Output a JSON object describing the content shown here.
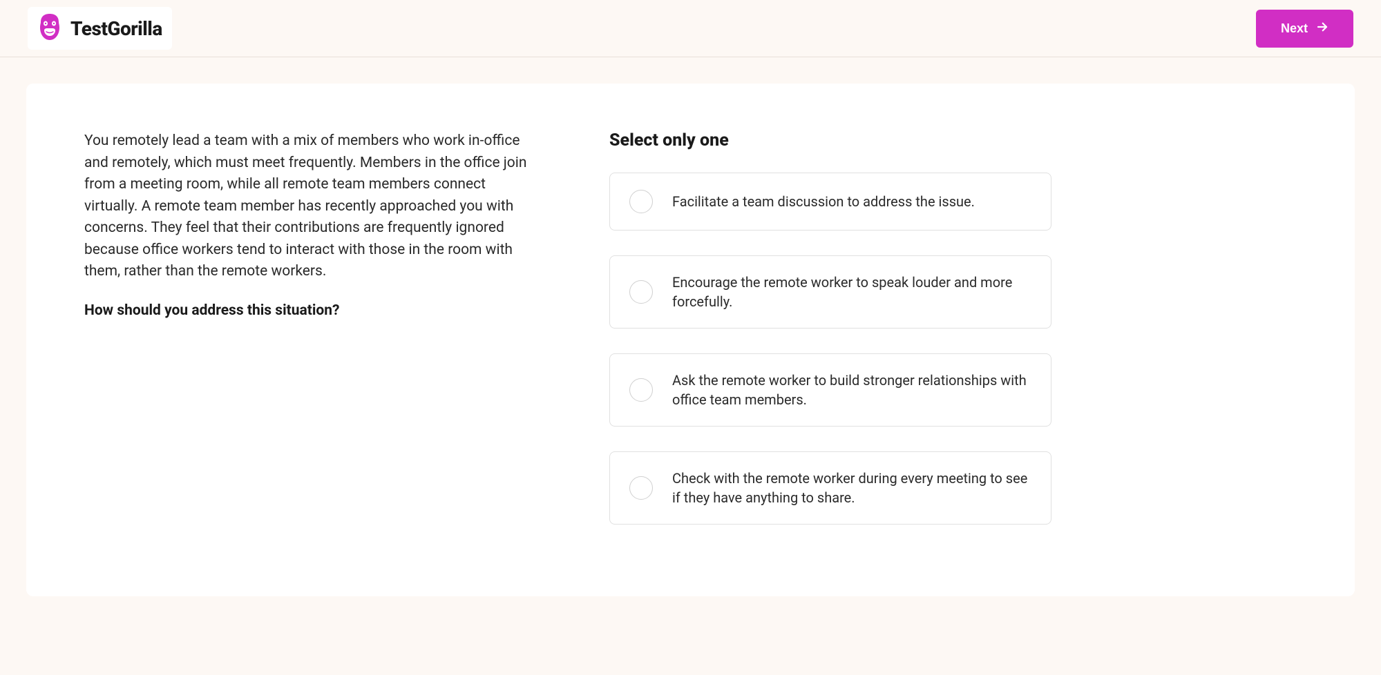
{
  "header": {
    "logo_text": "TestGorilla",
    "next_label": "Next"
  },
  "question": {
    "scenario": "You remotely lead a team with a mix of members who work in-office and remotely, which must meet frequently. Members in the office join from a meeting room, while all remote team members connect virtually. A remote team member has recently approached you with concerns. They feel that their contributions are frequently ignored because office workers tend to interact with those in the room with them, rather than the remote workers.",
    "prompt": "How should you address this situation?",
    "instruction": "Select only one",
    "options": [
      "Facilitate a team discussion to address the issue.",
      "Encourage the remote worker to speak louder and more forcefully.",
      "Ask the remote worker to build stronger relationships with office team members.",
      "Check with the remote worker during every meeting to see if they have anything to share."
    ]
  },
  "colors": {
    "accent": "#d12ec4",
    "background": "#fdf8f4"
  }
}
